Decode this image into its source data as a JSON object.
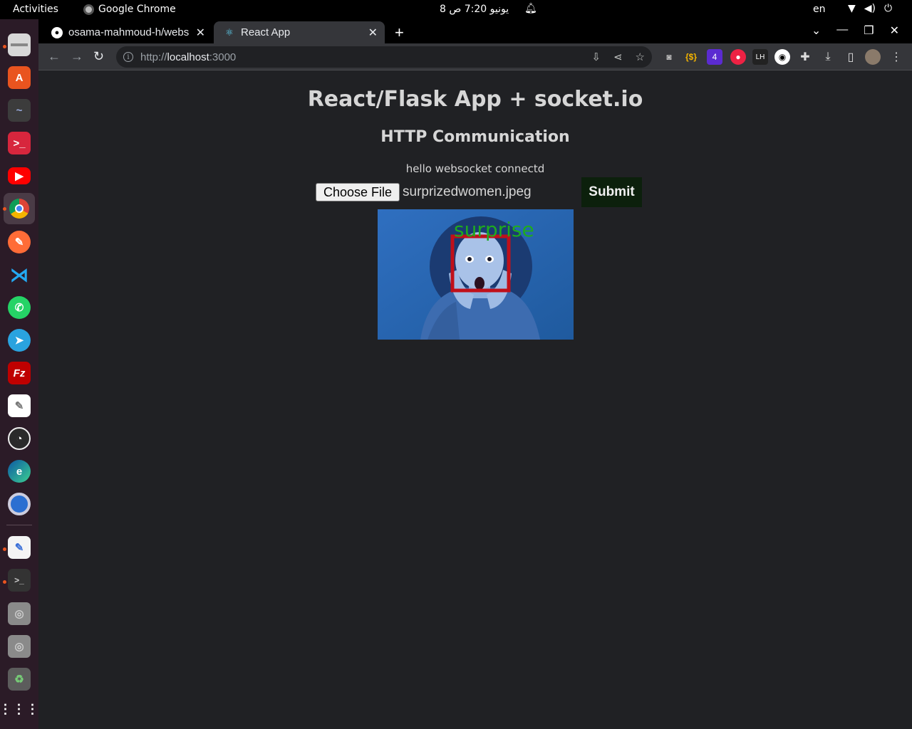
{
  "topbar": {
    "activities": "Activities",
    "app_name": "Google Chrome",
    "clock": "8 يونيو  7:20 ص",
    "language": "en"
  },
  "dock": {
    "apps": [
      "files-icon",
      "ubuntu-software-icon",
      "system-monitor-icon",
      "terminal-red-icon",
      "youtube-icon",
      "chrome-icon",
      "postman-icon",
      "vscode-icon",
      "whatsapp-icon",
      "telegram-icon",
      "filezilla-icon",
      "inkscape-icon",
      "obs-icon",
      "edge-icon",
      "chromium-icon",
      "text-editor-icon",
      "terminal-icon",
      "disk-icon",
      "disk-icon",
      "trash-icon",
      "app-grid-icon"
    ]
  },
  "browser": {
    "tabs": [
      {
        "title": "osama-mahmoud-h/webs",
        "icon": "github-icon"
      },
      {
        "title": "React App",
        "icon": "react-icon"
      }
    ],
    "url_scheme": "http://",
    "url_host": "localhost",
    "url_port": ":3000"
  },
  "page": {
    "title": "React/Flask App + socket.io",
    "subtitle": "HTTP Communication",
    "status": "hello websocket connectd",
    "choose_file_label": "Choose File",
    "file_name": "surprizedwomen.jpeg",
    "submit_label": "Submit",
    "result_image": {
      "emotion_label": "surprise",
      "box_color": "#c0101a",
      "label_color": "#1faa1f"
    }
  }
}
